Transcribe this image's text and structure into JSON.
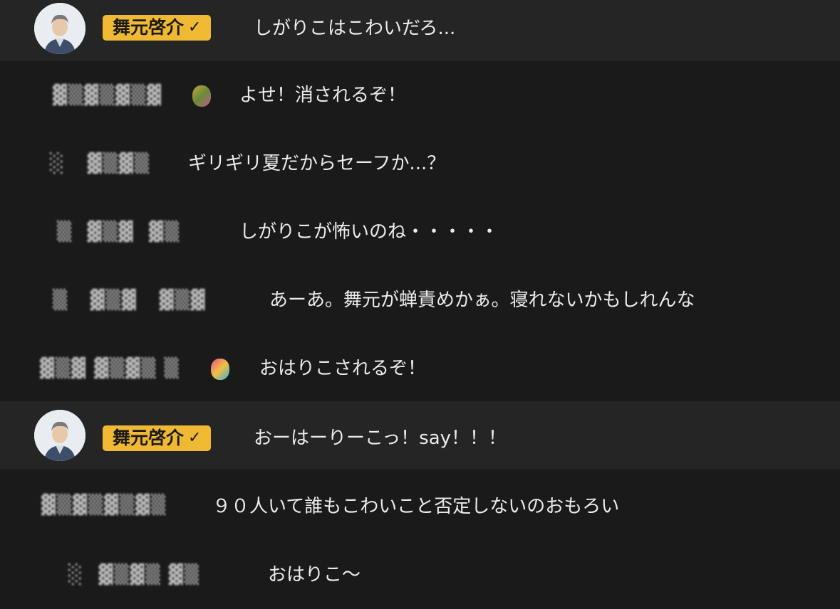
{
  "comments": [
    {
      "type": "owner",
      "name": "舞元啓介",
      "text": "しがりこはこわいだろ..."
    },
    {
      "type": "regular",
      "name": "",
      "text": "よせ！消されるぞ！"
    },
    {
      "type": "regular",
      "name": "",
      "text": "ギリギリ夏だからセーフか...？"
    },
    {
      "type": "regular",
      "name": "",
      "text": "しがりこが怖いのね・・・・・"
    },
    {
      "type": "regular",
      "name": "",
      "text": "あーあ。舞元が蝉責めかぁ。寝れないかもしれんな"
    },
    {
      "type": "regular",
      "name": "",
      "text": "おはりこされるぞ！"
    },
    {
      "type": "owner",
      "name": "舞元啓介",
      "text": "おーはーりーこっ！say！！！"
    },
    {
      "type": "regular",
      "name": "",
      "text": "９０人いて誰もこわいこと否定しないのおもろい"
    },
    {
      "type": "regular",
      "name": "",
      "text": "おはりこ〜"
    }
  ],
  "badge_check": "✓",
  "colors": {
    "owner_row_bg": "#252525",
    "badge_bg": "#f0b934",
    "page_bg": "#1a1a1a"
  }
}
